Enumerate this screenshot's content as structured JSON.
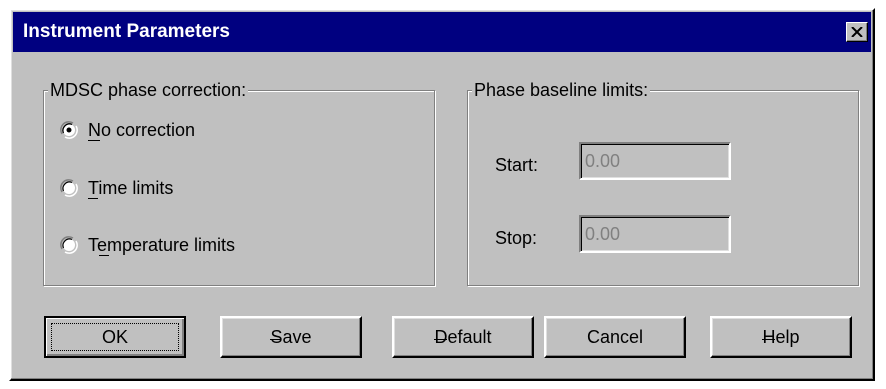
{
  "window": {
    "title": "Instrument Parameters",
    "close_icon": "close-x-icon"
  },
  "phase_correction": {
    "legend": "MDSC phase correction:",
    "selected": "no_correction",
    "options": [
      {
        "id": "no_correction",
        "label": "No correction",
        "mnemonic": "N",
        "checked": true
      },
      {
        "id": "time_limits",
        "label": "Time limits",
        "mnemonic": "T",
        "checked": false
      },
      {
        "id": "temperature_limits",
        "label": "Temperature limits",
        "mnemonic": "e",
        "checked": false
      }
    ]
  },
  "baseline_limits": {
    "legend": "Phase baseline limits:",
    "start_label": "Start:",
    "start_value": "0.00",
    "stop_label": "Stop:",
    "stop_value": "0.00",
    "disabled": true
  },
  "buttons": {
    "ok": "OK",
    "save": "Save",
    "default": "Default",
    "cancel": "Cancel",
    "help": "Help"
  },
  "colors": {
    "title_bar": "#000080",
    "face": "#c0c0c0",
    "disabled_text": "#808080"
  }
}
